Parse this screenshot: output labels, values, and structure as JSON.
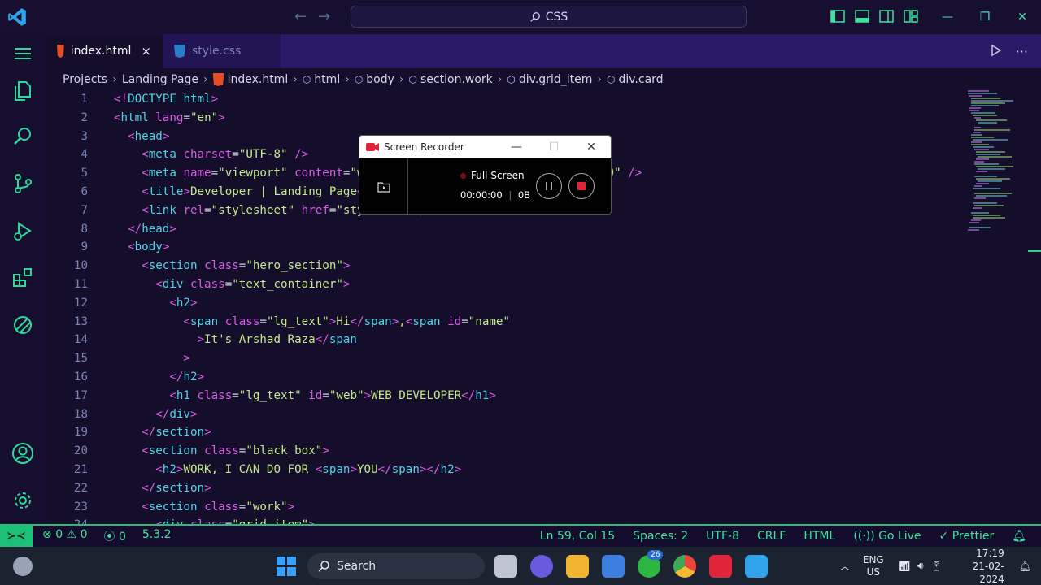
{
  "titlebar": {
    "search_text": "CSS"
  },
  "tabs": [
    {
      "label": "index.html",
      "close": "×"
    },
    {
      "label": "style.css"
    }
  ],
  "breadcrumb": [
    "Projects",
    "Landing Page",
    "index.html",
    "html",
    "body",
    "section.work",
    "div.grid_item",
    "div.card"
  ],
  "recorder": {
    "title": "Screen Recorder",
    "mode": "Full Screen",
    "time": "00:00:00",
    "size": "0B"
  },
  "statusbar": {
    "errors": "0",
    "warnings": "0",
    "ports": "0",
    "version": "5.3.2",
    "cursor": "Ln 59, Col 15",
    "spaces": "Spaces: 2",
    "encoding": "UTF-8",
    "eol": "CRLF",
    "language": "HTML",
    "golive": "Go Live",
    "prettier": "Prettier"
  },
  "taskbar": {
    "search": "Search",
    "badge": "26",
    "lang1": "ENG",
    "lang2": "US",
    "time": "17:19",
    "date": "21-02-2024"
  },
  "code_lines": [
    {
      "n": "1",
      "text": "<!DOCTYPE html>"
    },
    {
      "n": "2",
      "text": "<html lang=\"en\">"
    },
    {
      "n": "3",
      "text": "  <head>"
    },
    {
      "n": "4",
      "text": "    <meta charset=\"UTF-8\" />"
    },
    {
      "n": "5",
      "text": "    <meta name=\"viewport\" content=\"width=device-width, initial-scale=1.0\" />"
    },
    {
      "n": "6",
      "text": "    <title>Developer | Landing Page</title>"
    },
    {
      "n": "7",
      "text": "    <link rel=\"stylesheet\" href=\"style.css\" />"
    },
    {
      "n": "8",
      "text": "  </head>"
    },
    {
      "n": "9",
      "text": "  <body>"
    },
    {
      "n": "10",
      "text": "    <section class=\"hero_section\">"
    },
    {
      "n": "11",
      "text": "      <div class=\"text_container\">"
    },
    {
      "n": "12",
      "text": "        <h2>"
    },
    {
      "n": "13",
      "text": "          <span class=\"lg_text\">Hi</span>,<span id=\"name\""
    },
    {
      "n": "14",
      "text": "            >It's Arshad Raza</span"
    },
    {
      "n": "15",
      "text": "          >"
    },
    {
      "n": "16",
      "text": "        </h2>"
    },
    {
      "n": "17",
      "text": "        <h1 class=\"lg_text\" id=\"web\">WEB DEVELOPER</h1>"
    },
    {
      "n": "18",
      "text": "      </div>"
    },
    {
      "n": "19",
      "text": "    </section>"
    },
    {
      "n": "20",
      "text": "    <section class=\"black_box\">"
    },
    {
      "n": "21",
      "text": "      <h2>WORK, I CAN DO FOR <span>YOU</span></h2>"
    },
    {
      "n": "22",
      "text": "    </section>"
    },
    {
      "n": "23",
      "text": "    <section class=\"work\">"
    },
    {
      "n": "24",
      "text": "      <div class=\"grid_item\">"
    }
  ]
}
